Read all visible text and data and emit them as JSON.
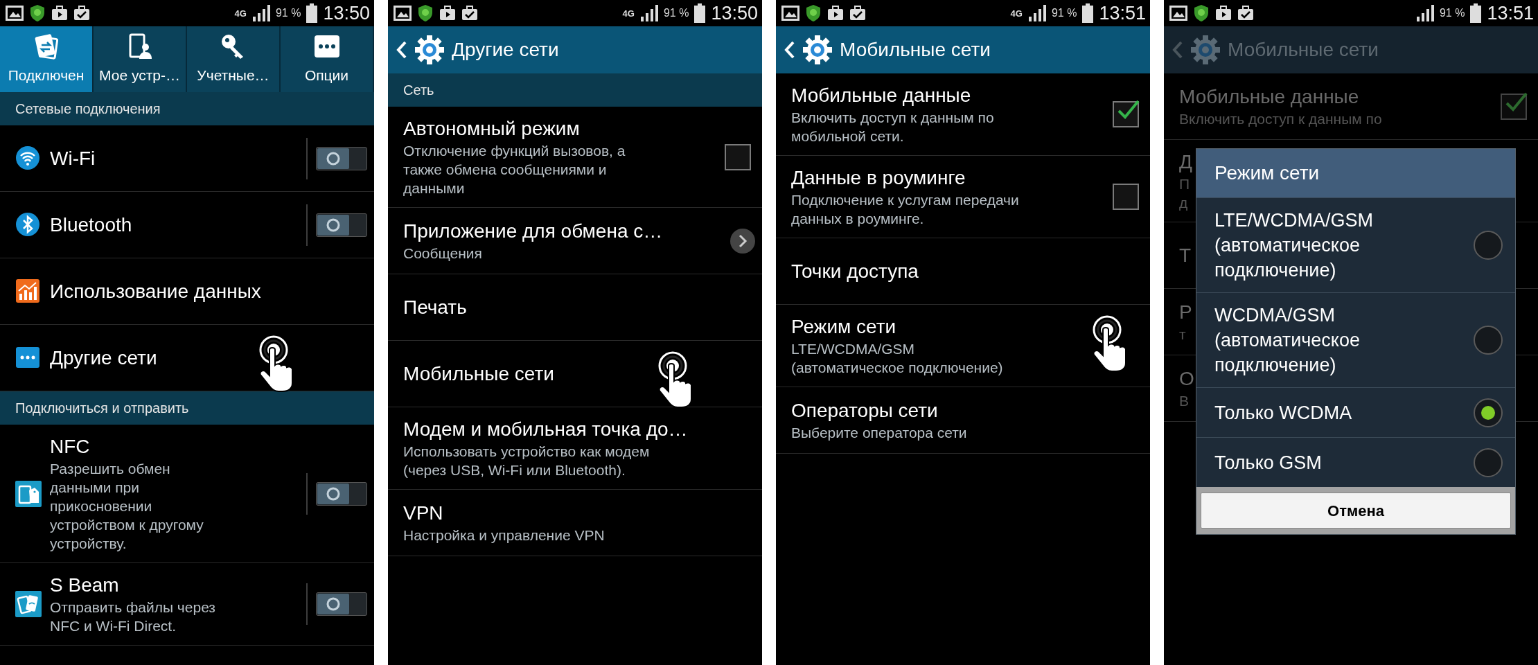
{
  "screens": [
    {
      "kind": "tabs",
      "dimmed": false,
      "status_bar": {
        "network": "4G",
        "battery": "91 %",
        "time": "13:50"
      },
      "tabs": [
        {
          "label": "Подключен",
          "selected": true
        },
        {
          "label": "Мое устр-…",
          "selected": false
        },
        {
          "label": "Учетные…",
          "selected": false
        },
        {
          "label": "Опции",
          "selected": false
        }
      ],
      "sections": [
        {
          "header": "Сетевые подключения",
          "items": [
            {
              "kind": "switch",
              "title": "Wi-Fi",
              "on": false,
              "touched": false
            },
            {
              "kind": "switch",
              "title": "Bluetooth",
              "on": false,
              "touched": false
            },
            {
              "kind": "plain",
              "title": "Использование данных",
              "touched": false
            },
            {
              "kind": "plain",
              "title": "Другие сети",
              "touched": true
            }
          ]
        },
        {
          "header": "Подключиться и отправить",
          "items": [
            {
              "kind": "switch",
              "title": "NFC",
              "summary": "Разрешить обмен\nданными при\nприкосновении\nустройством к другому\nустройству.",
              "on": false,
              "touched": false
            },
            {
              "kind": "switch",
              "title": "S Beam",
              "summary": "Отправить файлы через\nNFC и Wi-Fi Direct.",
              "on": false,
              "touched": false
            }
          ]
        }
      ]
    },
    {
      "kind": "subpage",
      "dimmed": false,
      "status_bar": {
        "network": "4G",
        "battery": "91 %",
        "time": "13:50"
      },
      "title": "Другие сети",
      "sections": [
        {
          "header": "Сеть",
          "items": [
            {
              "kind": "checkbox",
              "title": "Автономный режим",
              "summary": "Отключение функций вызовов, а\nтакже обмена сообщениями и\nданными",
              "checked": false,
              "touched": false
            },
            {
              "kind": "link",
              "title": "Приложение для обмена с…",
              "summary": "Сообщения",
              "touched": false
            },
            {
              "kind": "plain",
              "title": "Печать",
              "touched": false
            },
            {
              "kind": "plain",
              "title": "Мобильные сети",
              "touched": true
            },
            {
              "kind": "plain",
              "title": "Модем и мобильная точка до…",
              "summary": "Использовать устройство как модем\n(через USB, Wi-Fi или Bluetooth).",
              "touched": false
            },
            {
              "kind": "plain",
              "title": "VPN",
              "summary": "Настройка и управление VPN",
              "touched": false
            }
          ]
        }
      ]
    },
    {
      "kind": "subpage",
      "dimmed": false,
      "status_bar": {
        "network": "4G",
        "battery": "91 %",
        "time": "13:51"
      },
      "title": "Мобильные сети",
      "sections": [
        {
          "items": [
            {
              "kind": "checkbox",
              "title": "Мобильные данные",
              "summary": "Включить доступ к данным по\nмобильной сети.",
              "checked": true,
              "touched": false
            },
            {
              "kind": "checkbox",
              "title": "Данные в роуминге",
              "summary": "Подключение к услугам передачи\nданных в роуминге.",
              "checked": false,
              "touched": false
            },
            {
              "kind": "plain",
              "title": "Точки доступа",
              "touched": false
            },
            {
              "kind": "plain",
              "title": "Режим сети",
              "summary": "LTE/WCDMA/GSM\n(автоматическое подключение)",
              "touched": true
            },
            {
              "kind": "plain",
              "title": "Операторы сети",
              "summary": "Выберите оператора сети",
              "touched": false
            }
          ]
        }
      ]
    },
    {
      "kind": "subpage",
      "dimmed": true,
      "status_bar": {
        "battery": "91 %",
        "time": "13:51"
      },
      "title": "Мобильные сети",
      "sections": [
        {
          "items": [
            {
              "kind": "checkbox",
              "title": "Мобильные данные",
              "summary": "Включить доступ к данным по",
              "checked": true,
              "touched": false
            },
            {
              "kind": "plain",
              "title": "Д",
              "summary": "П\nд",
              "touched": false
            },
            {
              "kind": "plain",
              "title": "Т",
              "touched": false
            },
            {
              "kind": "plain",
              "title": "Р",
              "summary": "т",
              "touched": false
            },
            {
              "kind": "plain",
              "title": "О",
              "summary": "В",
              "touched": false
            }
          ]
        }
      ],
      "dialog": {
        "title": "Режим сети",
        "options": [
          {
            "label": "LTE/WCDMA/GSM (автоматическое подключение)",
            "selected": false
          },
          {
            "label": "WCDMA/GSM (автоматическое подключение)",
            "selected": false
          },
          {
            "label": "Только WCDMA",
            "selected": true
          },
          {
            "label": "Только GSM",
            "selected": false
          }
        ],
        "cancel": "Отмена"
      }
    }
  ]
}
